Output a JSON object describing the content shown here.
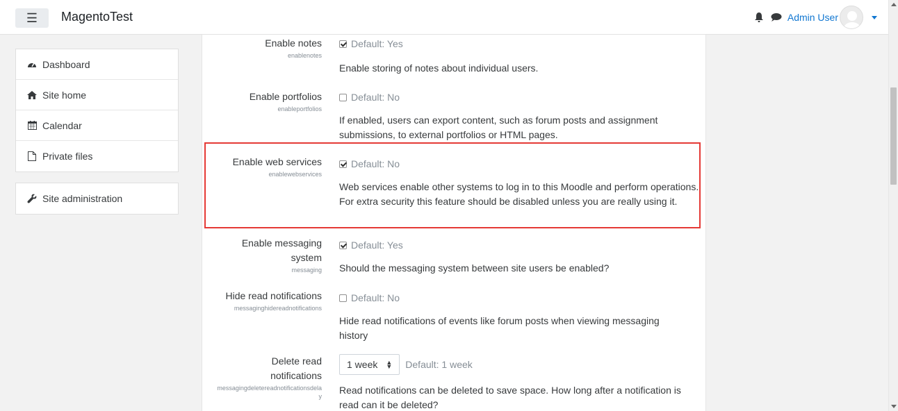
{
  "navbar": {
    "menu_icon": "hamburger-icon",
    "site_name": "MagentoTest",
    "notifications_icon": "bell-icon",
    "messages_icon": "chat-bubble-icon",
    "user_name": "Admin User",
    "user_menu_icon": "caret-down-icon"
  },
  "drawer": {
    "items": [
      {
        "label": "Dashboard",
        "icon": "tachometer-icon"
      },
      {
        "label": "Site home",
        "icon": "home-icon"
      },
      {
        "label": "Calendar",
        "icon": "calendar-icon"
      },
      {
        "label": "Private files",
        "icon": "file-icon"
      }
    ],
    "admin": {
      "label": "Site administration",
      "icon": "wrench-icon"
    }
  },
  "settings": [
    {
      "title": "Enable notes",
      "name": "enablenotes",
      "checked": true,
      "default": "Default: Yes",
      "description": "Enable storing of notes about individual users."
    },
    {
      "title": "Enable portfolios",
      "name": "enableportfolios",
      "checked": false,
      "default": "Default: No",
      "description": "If enabled, users can export content, such as forum posts and assignment submissions, to external portfolios or HTML pages."
    },
    {
      "title": "Enable web services",
      "name": "enablewebservices",
      "checked": true,
      "default": "Default: No",
      "description": "Web services enable other systems to log in to this Moodle and perform operations. For extra security this feature should be disabled unless you are really using it."
    },
    {
      "title": "Enable messaging system",
      "name": "messaging",
      "checked": true,
      "default": "Default: Yes",
      "description": "Should the messaging system between site users be enabled?"
    },
    {
      "title": "Hide read notifications",
      "name": "messaginghidereadnotifications",
      "checked": false,
      "default": "Default: No",
      "description": "Hide read notifications of events like forum posts when viewing messaging history"
    },
    {
      "title": "Delete read notifications",
      "name": "messagingdeletereadnotificationsdelay",
      "select_value": "1 week",
      "default": "Default: 1 week",
      "description": "Read notifications can be deleted to save space. How long after a notification is read can it be deleted?"
    }
  ],
  "colors": {
    "link": "#1177d1",
    "highlight_border": "#e53935"
  }
}
